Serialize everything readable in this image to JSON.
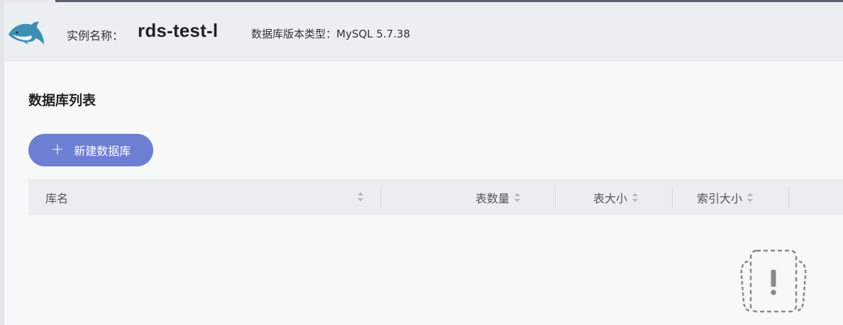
{
  "header": {
    "logo": "dolphin-logo",
    "instance_label": "实例名称：",
    "instance_name": "rds-test-l",
    "db_version": "数据库版本类型：MySQL 5.7.38"
  },
  "main": {
    "section_title": "数据库列表",
    "new_db_button": {
      "icon": "plus-icon",
      "label": "新建数据库"
    },
    "table": {
      "columns": [
        {
          "label": "库名",
          "sortable": true
        },
        {
          "label": "表数量",
          "sortable": true
        },
        {
          "label": "表大小",
          "sortable": true
        },
        {
          "label": "索引大小",
          "sortable": true
        }
      ],
      "rows": [],
      "empty_icon": "empty-state-icon"
    }
  },
  "colors": {
    "accent": "#6d7fd3",
    "header_bg": "#ebeff1",
    "table_head_bg": "#eaedf1"
  }
}
